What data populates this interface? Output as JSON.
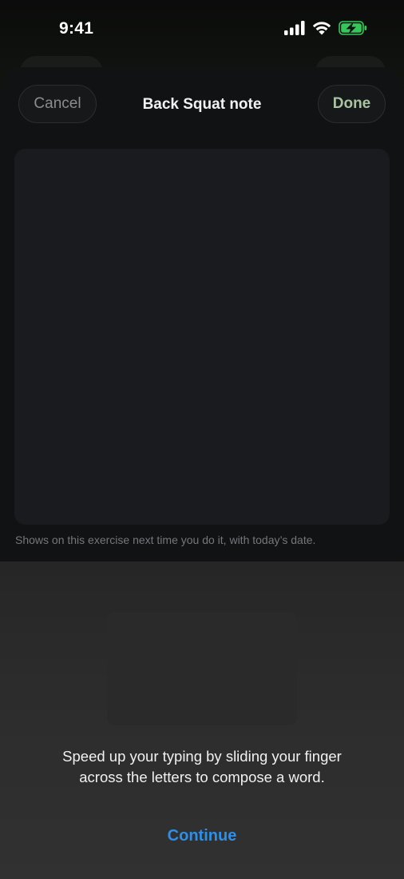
{
  "status_bar": {
    "time": "9:41",
    "icons": [
      "cellular-signal-icon",
      "wifi-icon",
      "battery-charging-icon"
    ],
    "battery_color": "#34c759"
  },
  "sheet": {
    "title": "Back Squat note",
    "cancel_label": "Cancel",
    "done_label": "Done",
    "note_value": "",
    "hint": "Shows on this exercise next time you do it, with today’s date."
  },
  "keyboard_tip": {
    "message_line1": "Speed up your typing by sliding your finger",
    "message_line2": "across the letters to compose a word.",
    "continue_label": "Continue"
  },
  "colors": {
    "accent_done": "#a8c4a0",
    "link_blue": "#2d8fe8",
    "sheet_bg": "#111214"
  }
}
